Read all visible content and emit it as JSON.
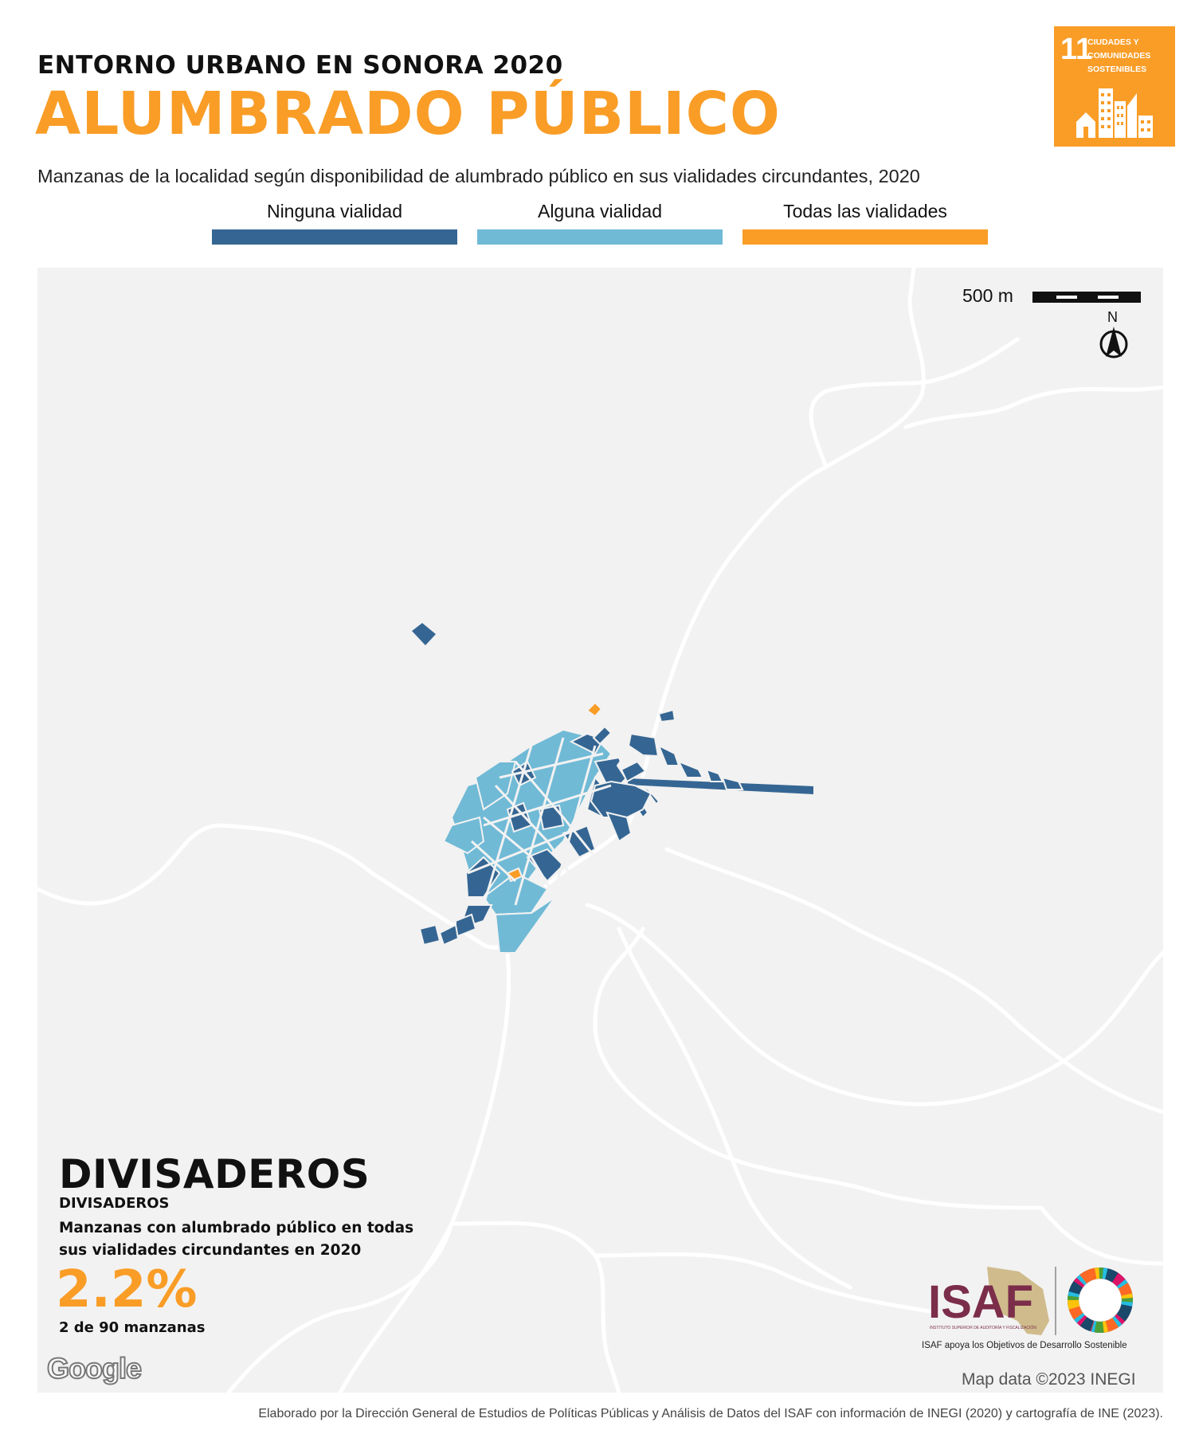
{
  "header": {
    "kicker": "ENTORNO URBANO EN SONORA 2020",
    "title": "ALUMBRADO PÚBLICO",
    "subtitle": "Manzanas de la localidad según disponibilidad de alumbrado público en sus vialidades circundantes, 2020"
  },
  "legend": [
    {
      "label": "Ninguna vialidad",
      "color": "#356693"
    },
    {
      "label": "Alguna vialidad",
      "color": "#70bad6"
    },
    {
      "label": "Todas las vialidades",
      "color": "#f99d27"
    }
  ],
  "sdg_badge": {
    "number": "11",
    "text": "CIUDADES Y COMUNIDADES SOSTENIBLES",
    "color": "#f99d27",
    "icon": "city-buildings-icon"
  },
  "map": {
    "scale_label": "500 m",
    "north_label": "N",
    "attribution": "Map data ©2023 INEGI",
    "google_label": "Google",
    "background_color": "#f2f2f2",
    "road_color": "#ffffff"
  },
  "locality": {
    "name_big": "DIVISADEROS",
    "name_small": "DIVISADEROS",
    "stat_label": "Manzanas con alumbrado público en todas sus vialidades circundantes en 2020",
    "stat_value": "2.2%",
    "stat_count": "2 de 90 manzanas"
  },
  "isaf": {
    "logo_text": "ISAF",
    "logo_subtext": "INSTITUTO SUPERIOR DE AUDITORÍA Y FISCALIZACIÓN",
    "tagline": "ISAF apoya los Objetivos de Desarrollo Sostenible",
    "brand_color": "#7b2d4a"
  },
  "footer": {
    "source": "Elaborado por la Dirección General de Estudios de Políticas Públicas y Análisis de Datos del ISAF con información de INEGI (2020) y cartografía de INE (2023)."
  }
}
